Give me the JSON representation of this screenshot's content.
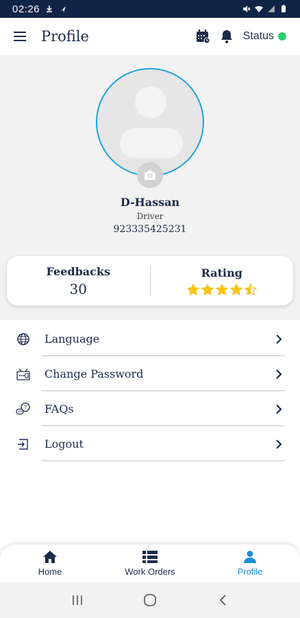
{
  "status_bar": {
    "time": "02:26"
  },
  "app_bar": {
    "title": "Profile",
    "status_label": "Status",
    "status_color": "#2ecc71"
  },
  "profile": {
    "name": "D-Hassan",
    "role": "Driver",
    "phone": "923335425231"
  },
  "stats": {
    "feedbacks_label": "Feedbacks",
    "feedbacks_value": "30",
    "rating_label": "Rating",
    "rating_value": 4.5,
    "rating_max": 5
  },
  "menu": {
    "items": [
      {
        "label": "Language",
        "icon": "globe-icon"
      },
      {
        "label": "Change Password",
        "icon": "password-icon"
      },
      {
        "label": "FAQs",
        "icon": "faq-icon"
      },
      {
        "label": "Logout",
        "icon": "logout-icon"
      }
    ]
  },
  "bottom_nav": {
    "items": [
      {
        "label": "Home",
        "icon": "home-icon",
        "active": false
      },
      {
        "label": "Work Orders",
        "icon": "list-icon",
        "active": false
      },
      {
        "label": "Profile",
        "icon": "person-icon",
        "active": true
      }
    ]
  },
  "colors": {
    "accent": "#1e8fd6",
    "navy": "#1c2a4a",
    "star": "#f5c518",
    "status_bar": "#0f2447"
  }
}
